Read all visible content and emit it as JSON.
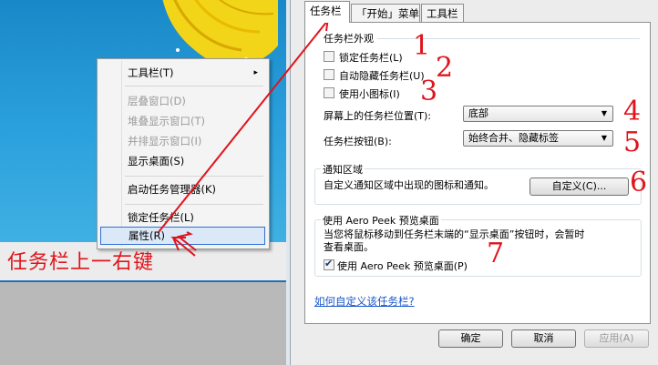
{
  "context_menu": {
    "items": [
      {
        "label": "工具栏(T)",
        "has_submenu": true,
        "enabled": true
      },
      {
        "label": "层叠窗口(D)",
        "enabled": false
      },
      {
        "label": "堆叠显示窗口(T)",
        "enabled": false
      },
      {
        "label": "并排显示窗口(I)",
        "enabled": false
      },
      {
        "label": "显示桌面(S)",
        "enabled": true
      },
      {
        "label": "启动任务管理器(K)",
        "enabled": true
      },
      {
        "label": "锁定任务栏(L)",
        "enabled": true
      },
      {
        "label": "属性(R)",
        "enabled": true,
        "highlighted": true
      }
    ],
    "submenu_arrow": "▸"
  },
  "annotation": {
    "caption": "任务栏上一右键",
    "numbers": [
      "1",
      "2",
      "3",
      "4",
      "5",
      "6",
      "7"
    ],
    "color": "#e0141c"
  },
  "dialog": {
    "tabs": [
      "任务栏",
      "「开始」菜单",
      "工具栏"
    ],
    "active_tab": "任务栏",
    "appearance": {
      "title": "任务栏外观",
      "lock_taskbar": {
        "label": "锁定任务栏(L)",
        "checked": false
      },
      "auto_hide": {
        "label": "自动隐藏任务栏(U)",
        "checked": false
      },
      "small_icons": {
        "label": "使用小图标(I)",
        "checked": false
      },
      "location_label": "屏幕上的任务栏位置(T):",
      "location_value": "底部",
      "buttons_label": "任务栏按钮(B):",
      "buttons_value": "始终合并、隐藏标签"
    },
    "notification": {
      "title": "通知区域",
      "description": "自定义通知区域中出现的图标和通知。",
      "customize_button": "自定义(C)..."
    },
    "aero_peek": {
      "title": "使用 Aero Peek 预览桌面",
      "description_line1": "当您将鼠标移动到任务栏末端的“显示桌面”按钮时，会暂时",
      "description_line2": "查看桌面。",
      "checkbox": {
        "label": "使用 Aero Peek 预览桌面(P)",
        "checked": true
      }
    },
    "help_link": "如何自定义该任务栏?",
    "ok_button": "确定",
    "cancel_button": "取消",
    "apply_button": "应用(A)"
  }
}
